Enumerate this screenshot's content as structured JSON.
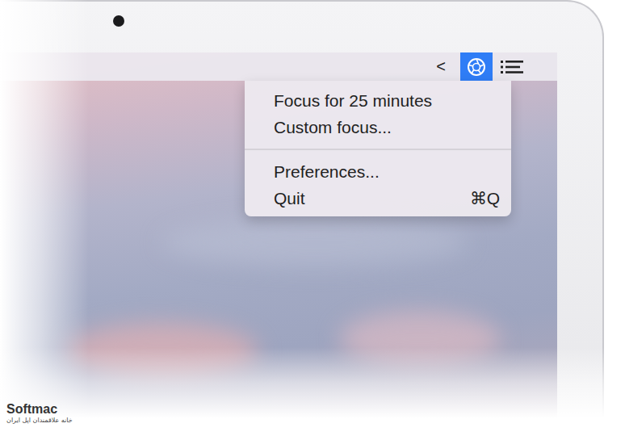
{
  "menu_bar": {
    "items": [
      {
        "kind": "text",
        "label": "<",
        "selected": false
      },
      {
        "kind": "focus-app",
        "selected": true
      },
      {
        "kind": "list",
        "selected": false
      }
    ]
  },
  "menu": {
    "sections": [
      [
        {
          "label": "Focus for 25 minutes"
        },
        {
          "label": "Custom focus..."
        }
      ],
      [
        {
          "label": "Preferences..."
        },
        {
          "label": "Quit",
          "shortcut": "⌘Q"
        }
      ]
    ]
  },
  "watermark": {
    "logo": "Softmac",
    "tagline": "خانه علاقمندان اپل ایران"
  }
}
